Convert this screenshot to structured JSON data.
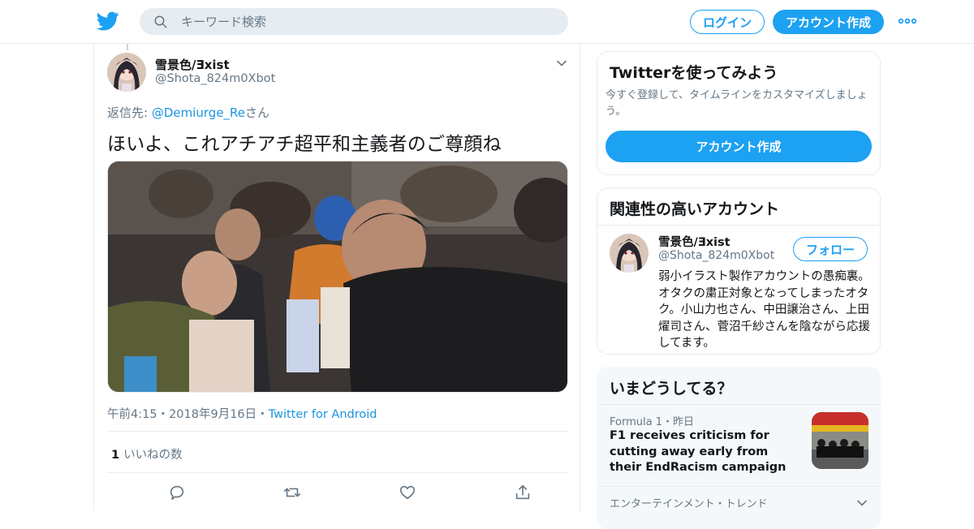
{
  "header": {
    "logo": "twitter-bird-icon",
    "search_placeholder": "キーワード検索",
    "login_label": "ログイン",
    "signup_label": "アカウント作成"
  },
  "tweet": {
    "author_name": "雪景色/Ǝxist",
    "author_handle": "@Shota_824m0Xbot",
    "reply_prefix": "返信先: ",
    "reply_mention": "@Demiurge_Re",
    "reply_suffix": "さん",
    "text": "ほいよ、これアチアチ超平和主義者のご尊顔ね",
    "time": "午前4:15",
    "date": "2018年9月16日",
    "source": "Twitter for Android",
    "like_count": "1",
    "like_label": "いいねの数",
    "meta_sep": "・"
  },
  "sidebar": {
    "signup_card": {
      "title": "Twitterを使ってみよう",
      "description": "今すぐ登録して、タイムラインをカスタマイズしましょう。",
      "button_label": "アカウント作成"
    },
    "related": {
      "title": "関連性の高いアカウント",
      "name": "雪景色/Ǝxist",
      "handle": "@Shota_824m0Xbot",
      "follow_label": "フォロー",
      "bio": "弱小イラスト製作アカウントの愚痴裏。オタクの粛正対象となってしまったオタク。小山力也さん、中田譲治さん、上田燿司さん、菅沼千紗さんを陰ながら応援してます。"
    },
    "trends": {
      "title": "いまどうしてる？",
      "item1_context": "Formula 1・昨日",
      "item1_title": "F1 receives criticism for cutting away early from their EndRacism campaign",
      "item2_context": "エンターテインメント・トレンド"
    }
  },
  "colors": {
    "accent": "#1da1f2",
    "link": "#1b95e0",
    "muted": "#657786"
  }
}
